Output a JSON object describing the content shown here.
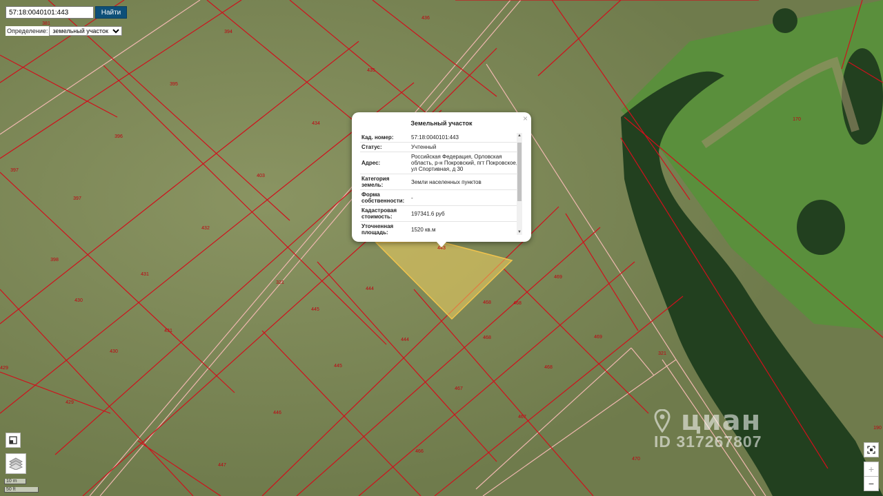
{
  "search": {
    "value": "57:18:0040101:443",
    "button_label": "Найти"
  },
  "definition": {
    "label": "Определение:",
    "selected": "земельный участок"
  },
  "popup": {
    "title": "Земельный участок",
    "close": "×",
    "rows": [
      {
        "key": "Кад. номер:",
        "value": "57:18:0040101:443"
      },
      {
        "key": "Статус:",
        "value": "Учтенный"
      },
      {
        "key": "Адрес:",
        "value": "Российская Федерация, Орловская область, р-н Покровский, пгт Покровское, ул Спортивная, д 30"
      },
      {
        "key": "Категория земель:",
        "value": "Земли населенных пунктов"
      },
      {
        "key": "Форма собственности:",
        "value": "-"
      },
      {
        "key": "Кадастровая стоимость:",
        "value": "197341.6 руб"
      },
      {
        "key": "Уточненная площадь:",
        "value": "1520 кв.м"
      }
    ]
  },
  "parcel_labels": [
    "381",
    "394",
    "436",
    "435",
    "395",
    "434",
    "396",
    "397",
    "397",
    "403",
    "432",
    "398",
    "431",
    "430",
    "431",
    "430",
    "429",
    "429",
    "321",
    "445",
    "444",
    "445",
    "444",
    "446",
    "447",
    "468",
    "468",
    "468",
    "469",
    "469",
    "468",
    "467",
    "467",
    "466",
    "470",
    "170",
    "321",
    "190",
    "443"
  ],
  "controls": {
    "zoom_in": "+",
    "zoom_out": "−"
  },
  "scale": {
    "metric": "10 m",
    "imperial": "50 ft"
  },
  "watermark": {
    "brand": "циан",
    "id": "ID 317267807"
  },
  "colors": {
    "parcel_border": "#d0101c",
    "selected_fill": "#f0d060",
    "road_line": "#f0b8b0",
    "search_button": "#0d4f78"
  }
}
